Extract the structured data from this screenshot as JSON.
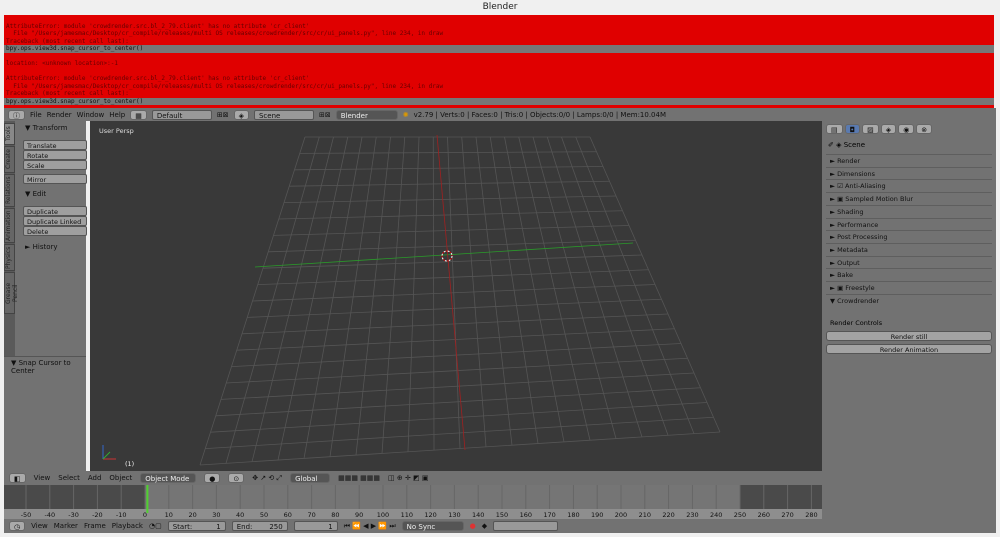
{
  "window": {
    "title": "Blender"
  },
  "console": {
    "lines": [
      {
        "text": "",
        "cmd": false
      },
      {
        "text": "AttributeError: module 'crowdrender.src.bl_2_79.client' has no attribute 'cr_client'",
        "cmd": false
      },
      {
        "text": "  File \"/Users/jamesmac/Desktop/cr_compile/releases/multi OS releases/crowdrender/src/cr/ui_panels.py\", line 234, in draw",
        "cmd": false
      },
      {
        "text": "Traceback (most recent call last):",
        "cmd": false
      },
      {
        "text": "bpy.ops.view3d.snap_cursor_to_center()",
        "cmd": true
      },
      {
        "text": "",
        "cmd": false
      },
      {
        "text": "location: <unknown location>:-1",
        "cmd": false
      },
      {
        "text": "",
        "cmd": false
      },
      {
        "text": "AttributeError: module 'crowdrender.src.bl_2_79.client' has no attribute 'cr_client'",
        "cmd": false
      },
      {
        "text": "  File \"/Users/jamesmac/Desktop/cr_compile/releases/multi OS releases/crowdrender/src/cr/ui_panels.py\", line 234, in draw",
        "cmd": false
      },
      {
        "text": "Traceback (most recent call last):",
        "cmd": false
      },
      {
        "text": "bpy.ops.view3d.snap_cursor_to_center()",
        "cmd": true
      }
    ]
  },
  "infobar": {
    "menus": [
      "File",
      "Render",
      "Window",
      "Help"
    ],
    "layout": "Default",
    "scene": "Scene",
    "engine": "Blender Render",
    "stats": "v2.79 | Verts:0 | Faces:0 | Tris:0 | Objects:0/0 | Lamps:0/0 | Mem:10.04M"
  },
  "toolshelf": {
    "tabs": [
      "Tools",
      "Create",
      "Relations",
      "Animation",
      "Physics",
      "Grease Pencil"
    ],
    "transform": "Transform",
    "transform_buttons": [
      "Translate",
      "Rotate",
      "Scale"
    ],
    "mirror": "Mirror",
    "edit": "Edit",
    "edit_buttons": [
      "Duplicate",
      "Duplicate Linked",
      "Delete"
    ],
    "history": "History",
    "operator": "Snap Cursor to Center"
  },
  "viewport": {
    "label": "User Persp",
    "frame": "(1)"
  },
  "view3d_header": {
    "menus": [
      "View",
      "Select",
      "Add",
      "Object"
    ],
    "mode": "Object Mode",
    "orientation": "Global"
  },
  "timeline": {
    "ticks": [
      -50,
      -40,
      -30,
      -20,
      -10,
      0,
      10,
      20,
      30,
      40,
      50,
      60,
      70,
      80,
      90,
      100,
      110,
      120,
      130,
      140,
      150,
      160,
      170,
      180,
      190,
      200,
      210,
      220,
      230,
      240,
      250,
      260,
      270,
      280
    ],
    "current_frame": 1,
    "start": 1,
    "end": 250
  },
  "timeline_header": {
    "menus": [
      "View",
      "Marker",
      "Frame",
      "Playback"
    ],
    "start_label": "Start:",
    "start": "1",
    "end_label": "End:",
    "end": "250",
    "current": "1",
    "sync": "No Sync"
  },
  "properties": {
    "scene": "Scene",
    "panels": [
      "Render",
      "Dimensions",
      "Anti-Aliasing",
      "Sampled Motion Blur",
      "Shading",
      "Performance",
      "Post Processing",
      "Metadata",
      "Output",
      "Bake",
      "Freestyle",
      "Crowdrender"
    ],
    "render_controls": "Render Controls",
    "render_still": "Render still",
    "render_animation": "Render Animation"
  },
  "colors": {
    "error": "#e00000",
    "viewport": "#393939",
    "panel": "#727272",
    "x_axis": "#a02020",
    "y_axis": "#2a9a2a",
    "playhead": "#50d030"
  }
}
